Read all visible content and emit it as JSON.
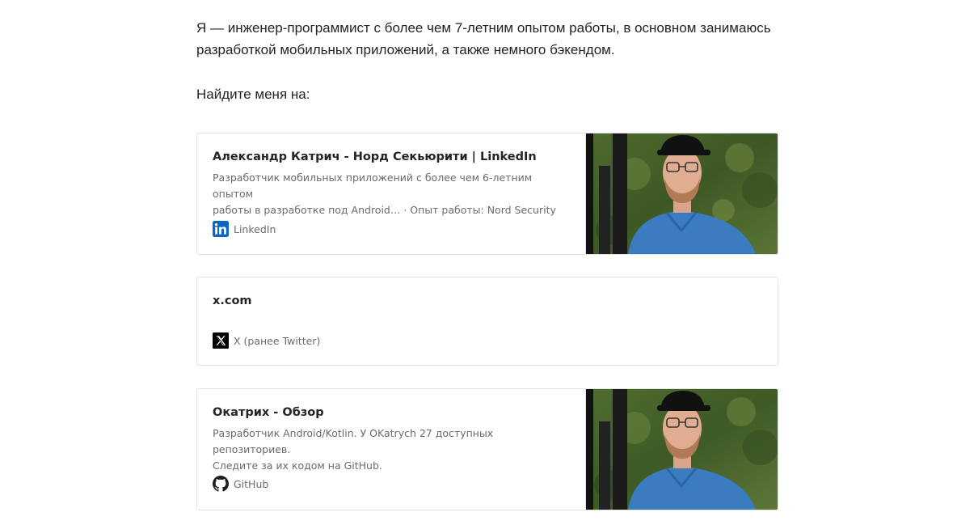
{
  "intro": {
    "text": "Я — инженер-программист с более чем 7-летним опытом работы, в основном занимаюсь разработкой мобильных приложений, а также немного бэкендом.",
    "find_me": "Найдите меня на:"
  },
  "cards": [
    {
      "title": "Александр Катрич - Норд Секьюрити | LinkedIn",
      "description_line1": "Разработчик мобильных приложений с более чем 6-летним опытом",
      "description_line2": "работы в разработке под Android… · Опыт работы: Nord Security ·…",
      "source": "LinkedIn",
      "icon": "linkedin-icon",
      "has_thumbnail": true
    },
    {
      "title": "x.com",
      "source": "X (ранее Twitter)",
      "icon": "x-logo-icon",
      "has_thumbnail": false
    },
    {
      "title": "Окатрих - Обзор",
      "description_line1": "Разработчик Android/Kotlin. У OKatrych 27 доступных репозиториев.",
      "description_line2": "Следите за их кодом на GitHub.",
      "source": "GitHub",
      "icon": "github-icon",
      "has_thumbnail": true
    }
  ],
  "colors": {
    "linkedin_blue": "#0a66c2",
    "text_primary": "#242424",
    "text_secondary": "#6b6b6b",
    "card_border": "#e3e3e3"
  }
}
